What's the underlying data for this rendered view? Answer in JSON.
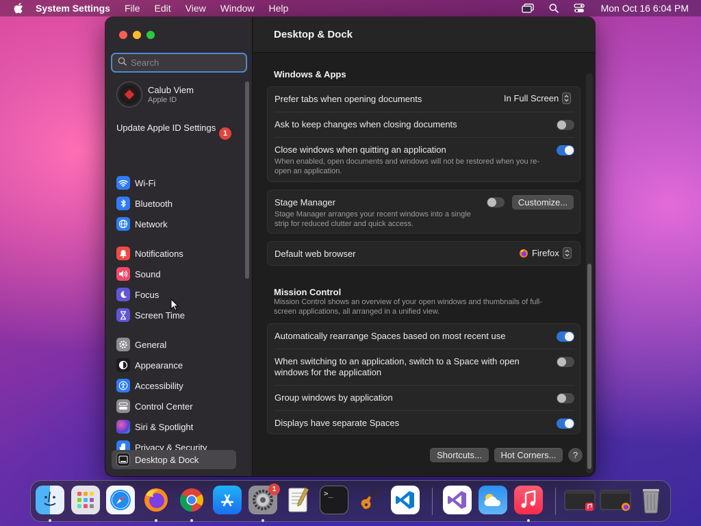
{
  "menubar": {
    "app_name": "System Settings",
    "menus": [
      "File",
      "Edit",
      "View",
      "Window",
      "Help"
    ],
    "clock": "Mon Oct 16  6:04 PM",
    "icons": [
      "screen-mirroring-icon",
      "spotlight-search-icon",
      "control-center-icon"
    ]
  },
  "sidebar": {
    "search_placeholder": "Search",
    "profile": {
      "name": "Calub Viem",
      "subtitle": "Apple ID"
    },
    "update": {
      "label": "Update Apple ID Settings",
      "badge": "1"
    },
    "items": [
      {
        "label": "Wi-Fi",
        "icon": "wifi-icon",
        "color": "#2f7cf6"
      },
      {
        "label": "Bluetooth",
        "icon": "bluetooth-icon",
        "color": "#2f7cf6"
      },
      {
        "label": "Network",
        "icon": "globe-icon",
        "color": "#2f7cf6"
      },
      {
        "label": "Notifications",
        "icon": "bell-icon",
        "color": "#f04a45"
      },
      {
        "label": "Sound",
        "icon": "speaker-icon",
        "color": "#f04a6a"
      },
      {
        "label": "Focus",
        "icon": "moon-icon",
        "color": "#6156d6"
      },
      {
        "label": "Screen Time",
        "icon": "hourglass-icon",
        "color": "#6156d6"
      },
      {
        "label": "General",
        "icon": "gear-icon",
        "color": "#8d8d92"
      },
      {
        "label": "Appearance",
        "icon": "appearance-icon",
        "color": "#1c1c1e"
      },
      {
        "label": "Accessibility",
        "icon": "accessibility-icon",
        "color": "#2f7cf6"
      },
      {
        "label": "Control Center",
        "icon": "control-center-icon",
        "color": "#8d8d92"
      },
      {
        "label": "Siri & Spotlight",
        "icon": "siri-icon",
        "color": "#7a4bd6"
      },
      {
        "label": "Privacy & Security",
        "icon": "hand-icon",
        "color": "#2f7cf6"
      },
      {
        "label": "Desktop & Dock",
        "icon": "dock-icon",
        "color": "#1c1c1e"
      }
    ]
  },
  "content": {
    "title": "Desktop & Dock",
    "windows_apps": {
      "title": "Windows & Apps",
      "prefer_tabs": {
        "label": "Prefer tabs when opening documents",
        "value": "In Full Screen"
      },
      "ask_keep": {
        "label": "Ask to keep changes when closing documents",
        "on": false
      },
      "close_windows": {
        "label": "Close windows when quitting an application",
        "description": "When enabled, open documents and windows will not be restored when you re-open an application.",
        "on": true
      }
    },
    "stage_manager": {
      "label": "Stage Manager",
      "description": "Stage Manager arranges your recent windows into a single strip for reduced clutter and quick access.",
      "on": false,
      "customize_label": "Customize..."
    },
    "browser": {
      "label": "Default web browser",
      "value": "Firefox"
    },
    "mission_control": {
      "title": "Mission Control",
      "description": "Mission Control shows an overview of your open windows and thumbnails of full-screen applications, all arranged in a unified view.",
      "rows": [
        {
          "label": "Automatically rearrange Spaces based on most recent use",
          "on": true
        },
        {
          "label": "When switching to an application, switch to a Space with open windows for the application",
          "on": false
        },
        {
          "label": "Group windows by application",
          "on": false
        },
        {
          "label": "Displays have separate Spaces",
          "on": true
        }
      ]
    },
    "footer": {
      "shortcuts_label": "Shortcuts...",
      "hot_corners_label": "Hot Corners...",
      "help_label": "?"
    }
  },
  "dock": {
    "apps": [
      {
        "name": "Finder",
        "icon": "finder-icon"
      },
      {
        "name": "Launchpad",
        "icon": "launchpad-icon"
      },
      {
        "name": "Safari",
        "icon": "safari-icon"
      },
      {
        "name": "Firefox",
        "icon": "firefox-icon"
      },
      {
        "name": "Google Chrome",
        "icon": "chrome-icon"
      },
      {
        "name": "App Store",
        "icon": "app-store-icon"
      },
      {
        "name": "System Settings",
        "icon": "system-settings-icon",
        "badge": "1"
      },
      {
        "name": "TextEdit",
        "icon": "textedit-icon"
      },
      {
        "name": "Terminal",
        "icon": "terminal-icon",
        "text": ">_"
      },
      {
        "name": "GarageBand",
        "icon": "garageband-icon"
      },
      {
        "name": "Visual Studio Code",
        "icon": "vscode-icon"
      },
      {
        "name": "Visual Studio",
        "icon": "visual-studio-icon"
      },
      {
        "name": "Weather",
        "icon": "weather-icon"
      },
      {
        "name": "Music",
        "icon": "music-icon"
      },
      {
        "name": "Music Window",
        "icon": "minimized-window-icon"
      },
      {
        "name": "Firefox Window",
        "icon": "minimized-window-icon"
      },
      {
        "name": "Trash",
        "icon": "trash-icon"
      }
    ]
  }
}
